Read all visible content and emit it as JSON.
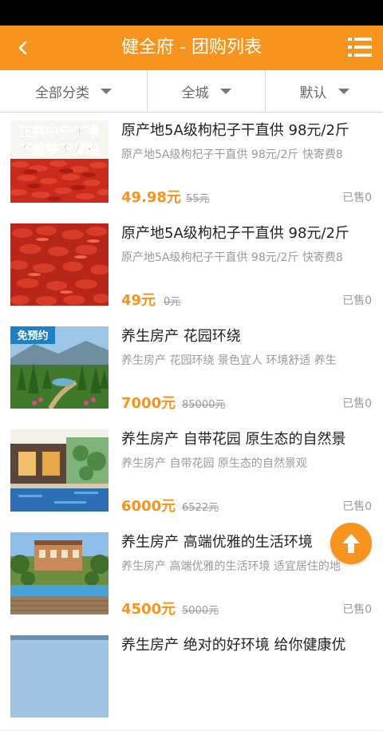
{
  "header": {
    "title": "健全府 - 团购列表"
  },
  "filters": [
    {
      "label": "全部分类"
    },
    {
      "label": "全城"
    },
    {
      "label": "默认"
    }
  ],
  "items": [
    {
      "title": "原产地5A级枸杞子干直供 98元/2斤",
      "desc": "原产地5A级枸杞子干直供 98元/2斤 快寄费8",
      "price": "49.98元",
      "orig": "55元",
      "sold": "已售0",
      "thumb_text": [
        "正宗中宁干净",
        "不结块不发粘"
      ]
    },
    {
      "title": "原产地5A级枸杞子干直供 98元/2斤",
      "desc": "原产地5A级枸杞子干直供 98元/2斤 快寄费8",
      "price": "49元",
      "orig": "0元",
      "sold": "已售0"
    },
    {
      "title": "养生房产 花园环绕",
      "desc": "养生房产 花园环绕 景色宜人 环境舒适 养生",
      "price": "7000元",
      "orig": "85000元",
      "sold": "已售0",
      "badge": "免预约"
    },
    {
      "title": "养生房产 自带花园 原生态的自然景",
      "desc": "养生房产 自带花园 原生态的自然景观",
      "price": "6000元",
      "orig": "6522元",
      "sold": "已售0"
    },
    {
      "title": "养生房产 高端优雅的生活环境",
      "desc": "养生房产 高端优雅的生活环境 适宜居住的地",
      "price": "4500元",
      "orig": "5000元",
      "sold": "已售0"
    },
    {
      "title": "养生房产 绝对的好环境 给你健康优",
      "desc": "",
      "price": "",
      "orig": "",
      "sold": ""
    }
  ],
  "colors": {
    "accent": "#f7941d",
    "text": "#222222",
    "muted": "#9a9a9a"
  },
  "icons": {
    "back": "chevron-left-icon",
    "menu": "list-menu-icon",
    "fab": "arrow-up-icon"
  }
}
